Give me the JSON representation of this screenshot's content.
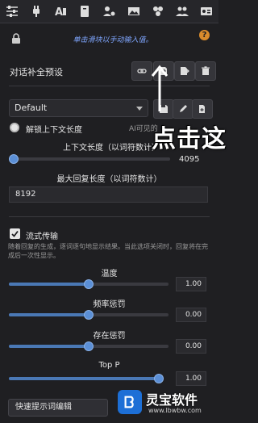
{
  "topbar": {
    "icons": [
      "sliders-icon",
      "plug-icon",
      "font-icon",
      "book-icon",
      "user-settings-icon",
      "image-icon",
      "extensions-icon",
      "users-icon",
      "id-card-icon"
    ]
  },
  "lock_hint": "单击滑块以手动输入值。",
  "help_icon": "?",
  "preset": {
    "section_title": "对话补全预设",
    "selected": "Default"
  },
  "unlock_context": {
    "label": "解锁上下文长度",
    "note": "AI可见的"
  },
  "context_size": {
    "label": "上下文长度（以词符数计）",
    "value": "4095",
    "fraction": 0.03
  },
  "max_response": {
    "label": "最大回复长度（以词符数计）",
    "value": "8192"
  },
  "streaming": {
    "label": "流式传输",
    "description": "随着回复的生成，逐词逐句地显示结果。当此选项关闭时，回复将在完成后一次性显示。"
  },
  "sliders": [
    {
      "label": "温度",
      "value": "1.00",
      "fraction": 0.5
    },
    {
      "label": "频率惩罚",
      "value": "0.00",
      "fraction": 0.5
    },
    {
      "label": "存在惩罚",
      "value": "0.00",
      "fraction": 0.5
    },
    {
      "label": "Top P",
      "value": "1.00",
      "fraction": 1.0
    }
  ],
  "quick_prompt": "快速提示词编辑",
  "overlay": {
    "text": "点击这"
  },
  "watermark": {
    "name": "灵宝软件",
    "url": "www.lbwbw.com"
  },
  "colors": {
    "accent": "#4a78b5",
    "hint": "#7fa6ff",
    "help": "#d88b2c",
    "background": "#1f1f22"
  }
}
